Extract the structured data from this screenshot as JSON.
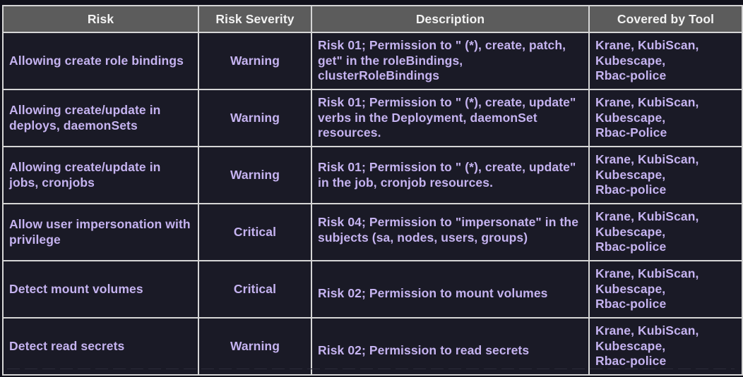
{
  "table": {
    "headers": [
      "Risk",
      "Risk Severity",
      "Description",
      "Covered by Tool"
    ],
    "rows": [
      {
        "risk": "Allowing create role bindings",
        "severity": "Warning",
        "description": "Risk 01;  Permission to \" (*), create, patch, get\" in the roleBindings, clusterRoleBindings",
        "tools": [
          "Krane, KubiScan,",
          "Kubescape,",
          "Rbac-police"
        ]
      },
      {
        "risk": "Allowing create/update in deploys, daemonSets",
        "severity": "Warning",
        "description": "Risk 01; Permission to \" (*), create, update\" verbs in the Deployment, daemonSet resources.",
        "tools": [
          "Krane, KubiScan,",
          "Kubescape,",
          "Rbac-Police"
        ]
      },
      {
        "risk": "Allowing create/update in jobs, cronjobs",
        "severity": "Warning",
        "description": "Risk 01; Permission to \" (*), create, update\" in the job, cronjob resources.",
        "tools": [
          "Krane, KubiScan,",
          "Kubescape,",
          "Rbac-police"
        ]
      },
      {
        "risk": "Allow user impersonation with privilege",
        "severity": "Critical",
        "description": "Risk 04; Permission to \"impersonate\" in the subjects (sa, nodes, users, groups)",
        "tools": [
          "Krane, KubiScan,",
          "Kubescape,",
          "Rbac-police"
        ]
      },
      {
        "risk": "Detect mount volumes",
        "severity": "Critical",
        "description": "Risk 02; Permission to mount volumes",
        "tools": [
          "Krane, KubiScan,",
          "Kubescape,",
          "Rbac-police"
        ]
      },
      {
        "risk": "Detect read secrets",
        "severity": "Warning",
        "description": "Risk 02; Permission to read secrets",
        "tools": [
          "Krane, KubiScan,",
          "Kubescape,",
          "Rbac-police"
        ]
      }
    ]
  }
}
